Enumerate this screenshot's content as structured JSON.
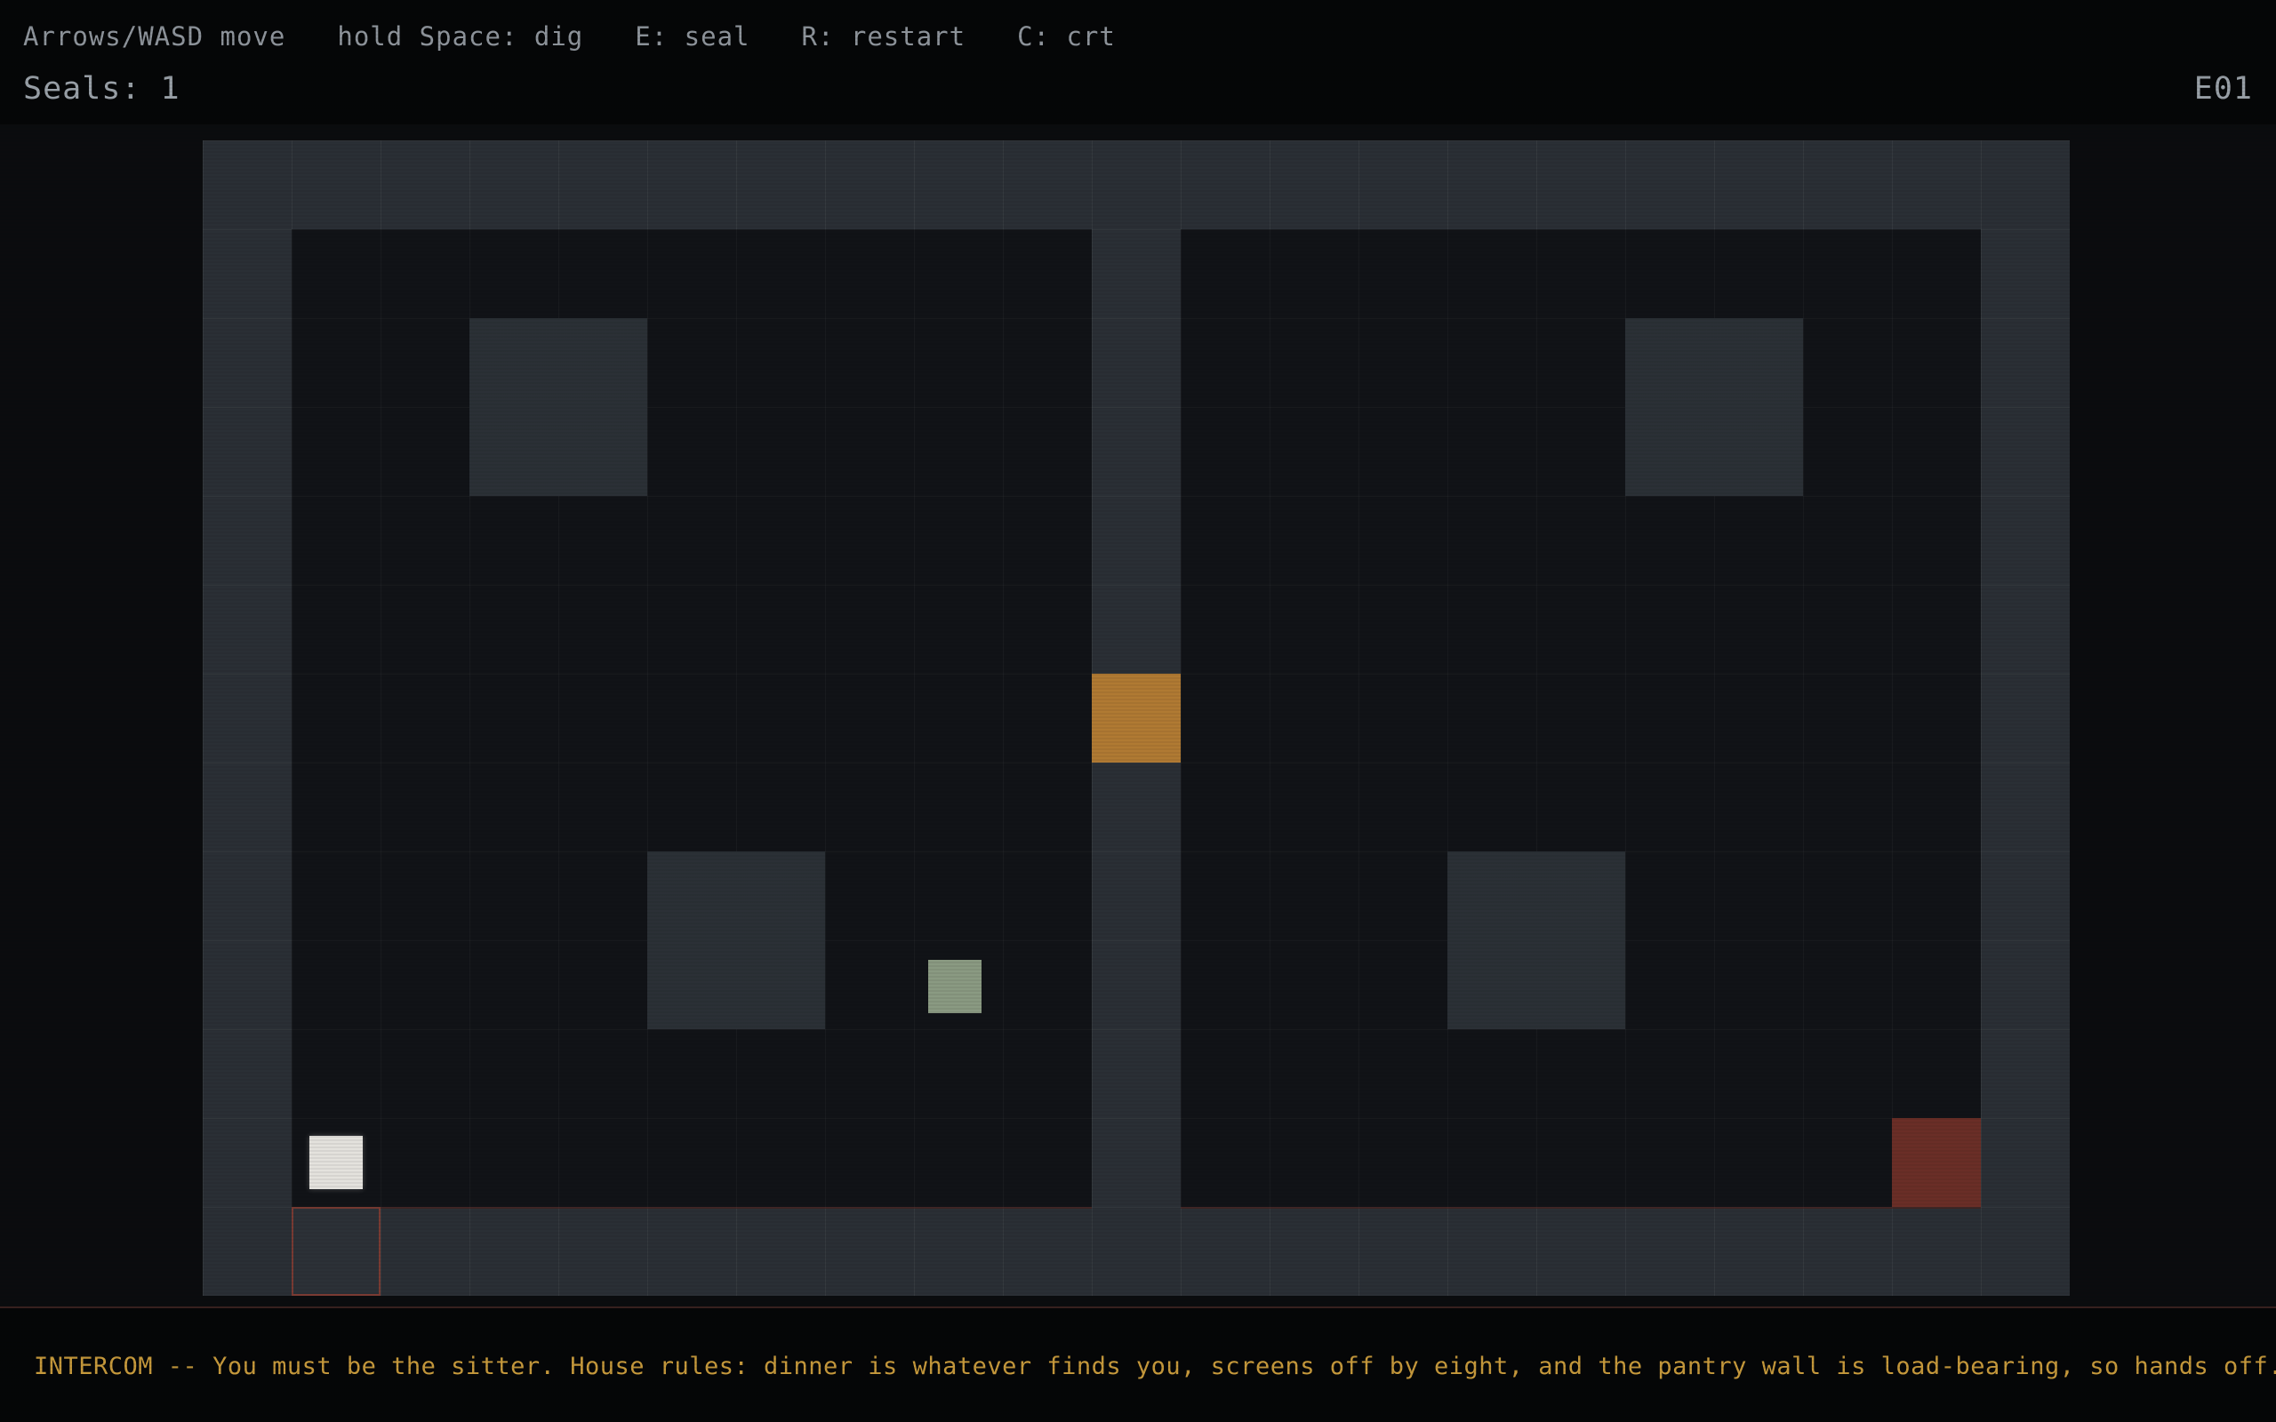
{
  "hud": {
    "controls": [
      {
        "key": "move",
        "label": "Arrows/WASD move"
      },
      {
        "key": "dig",
        "label": "hold Space: dig"
      },
      {
        "key": "seal",
        "label": "E: seal"
      },
      {
        "key": "restart",
        "label": "R: restart"
      },
      {
        "key": "crt",
        "label": "C: crt"
      }
    ],
    "seals_label": "Seals: 1",
    "level_code": "E01"
  },
  "message": {
    "text": "INTERCOM -- You must be the sitter. House rules: dinner is whatever finds you, screens off by eight, and the pantry wall is load-bearing, so hands off. I"
  },
  "colors": {
    "wall": "#2a2f35",
    "floor": "#111317",
    "door": "#b07a33",
    "exit": "#6a2e27",
    "player": "#e4e2dd",
    "creature": "#8a9a82",
    "hud_text": "#9aa1a8",
    "message_text": "#c79a3c"
  }
}
